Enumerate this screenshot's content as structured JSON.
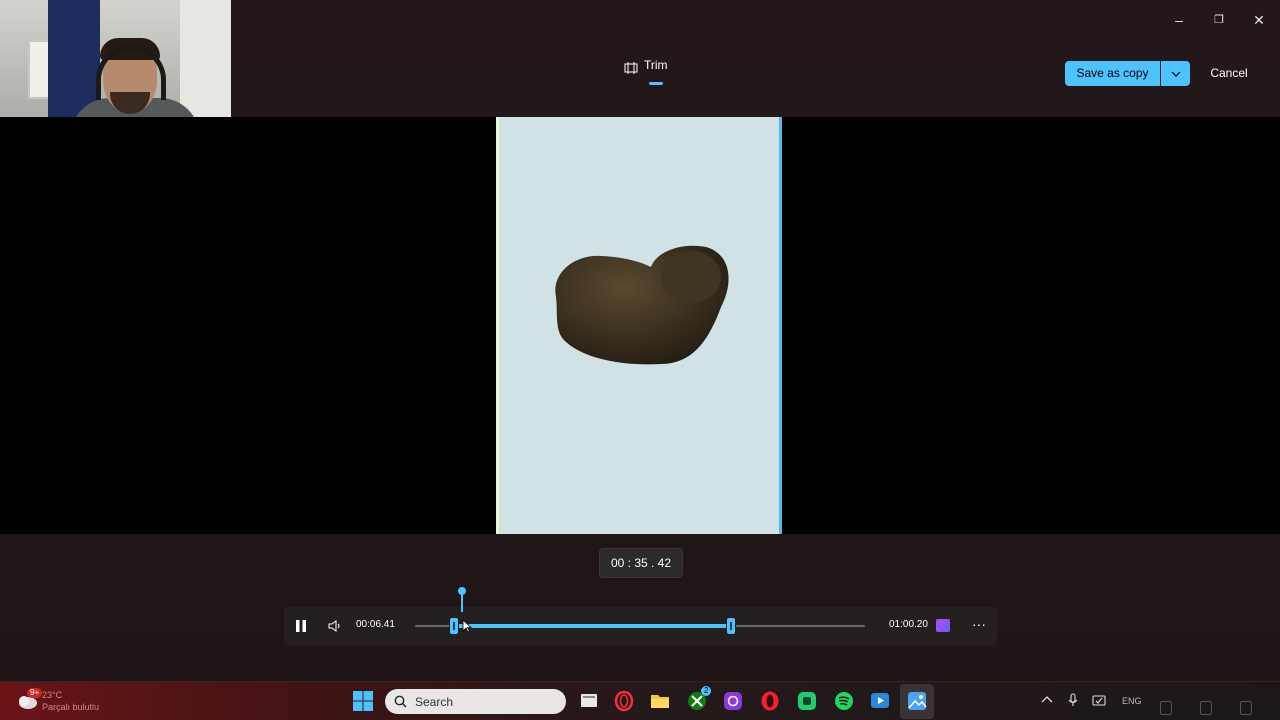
{
  "header": {
    "tab_label": "Trim",
    "save_label": "Save as copy",
    "cancel_label": "Cancel"
  },
  "window_controls": {
    "minimize_glyph": "–",
    "restore_glyph": "❐",
    "close_glyph": "✕"
  },
  "player": {
    "tooltip_time": "00 : 35 . 42",
    "start_time": "00:06.41",
    "end_time": "01:00.20",
    "more_glyph": "···",
    "trim_start_fraction": 0.087,
    "trim_end_fraction": 0.702,
    "playhead_fraction": 0.104
  },
  "taskbar": {
    "weather_badge": "9+",
    "weather_temp": "23°C",
    "weather_condition": "Parçalı bulutlu",
    "search_label": "Search",
    "xbox_badge": "2",
    "language": "ENG",
    "icons": [
      "windows-start-icon",
      "search-icon",
      "task-view-icon",
      "opera-gx-icon",
      "file-explorer-icon",
      "xbox-icon",
      "photos-icon",
      "opera-icon",
      "whatsapp-icon",
      "spotify-icon",
      "clipchamp-icon",
      "photos-editor-icon"
    ]
  },
  "colors": {
    "accent": "#4cc2ff",
    "background": "#1f1517",
    "video_bg": "#000000",
    "taskbar_red": "#6a1417"
  }
}
